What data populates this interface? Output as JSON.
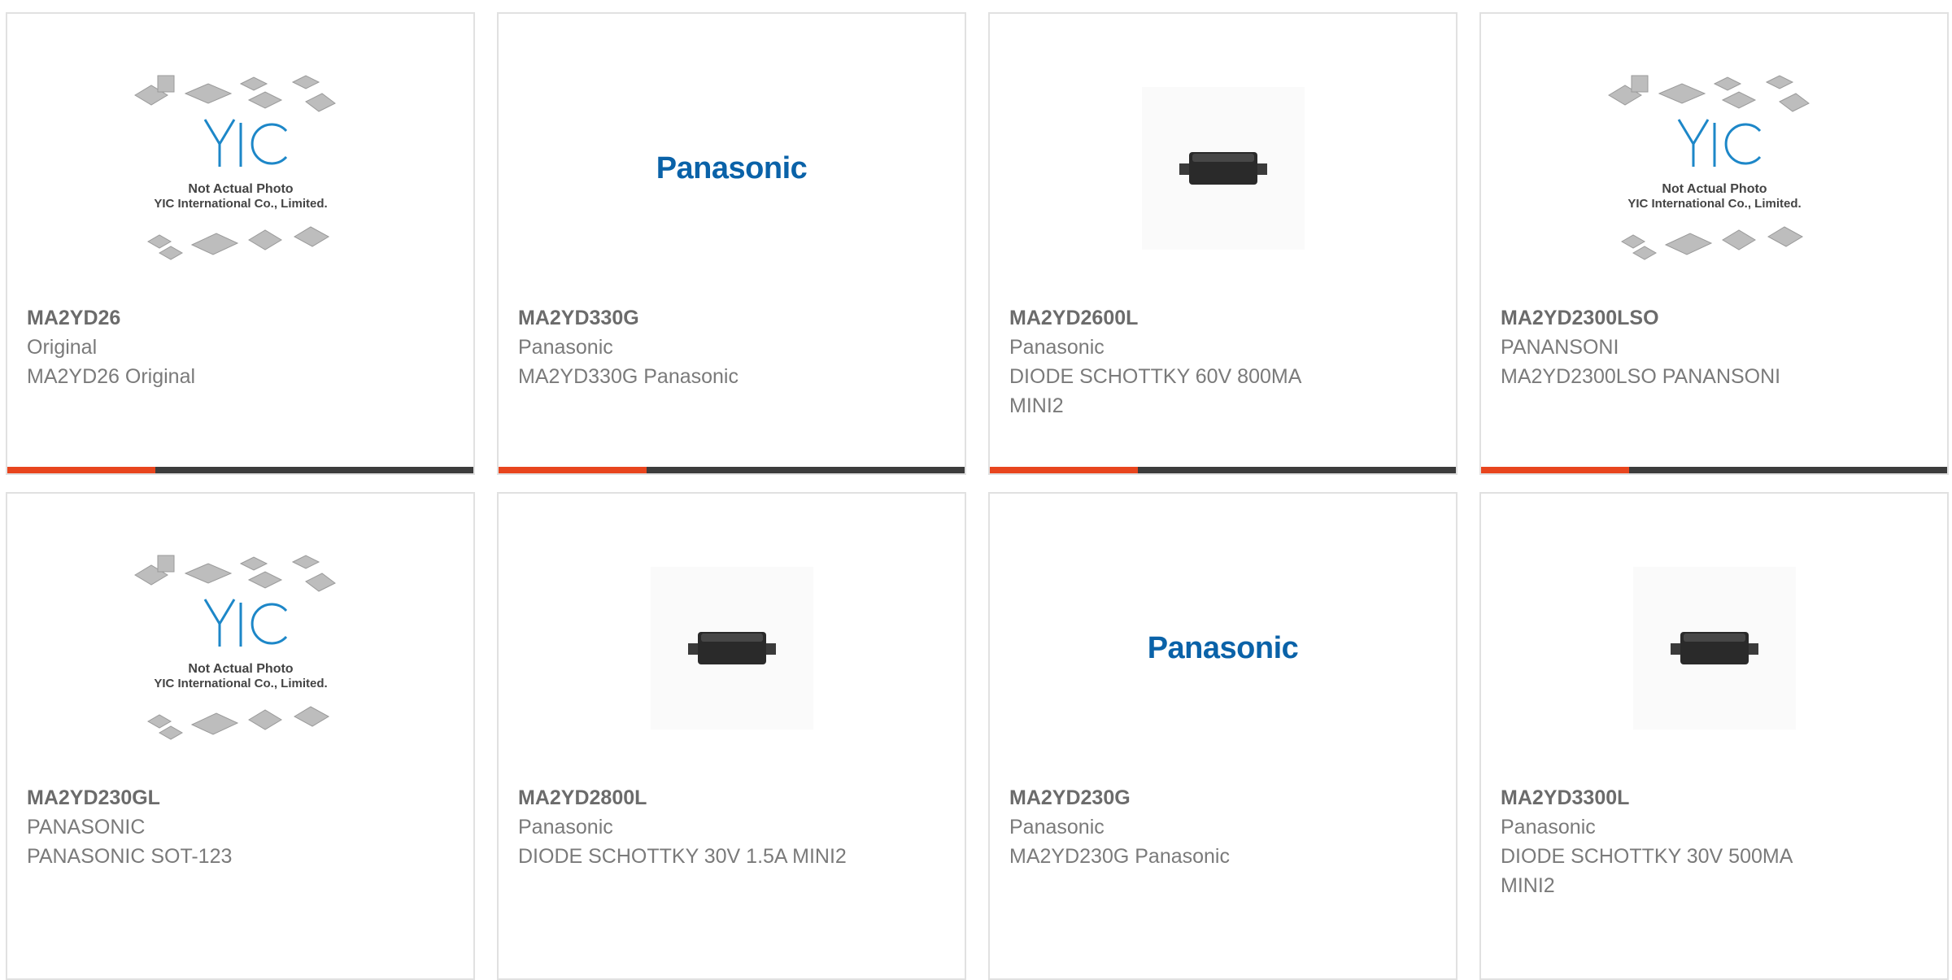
{
  "colors": {
    "accent": "#e8451e",
    "bar": "#3c3c3c",
    "panasonic_blue": "#0a62a8",
    "yic_blue": "#1d87c8"
  },
  "placeholder": {
    "line1": "Not Actual Photo",
    "line2": "YIC International Co., Limited.",
    "logo": "YIC"
  },
  "products": [
    {
      "part": "MA2YD26",
      "brand": "Original",
      "desc": "MA2YD26 Original",
      "image": "yic-placeholder"
    },
    {
      "part": "MA2YD330G",
      "brand": "Panasonic",
      "desc": "MA2YD330G Panasonic",
      "image": "panasonic-logo",
      "logo_text": "Panasonic"
    },
    {
      "part": "MA2YD2600L",
      "brand": "Panasonic",
      "desc": "DIODE SCHOTTKY 60V 800MA MINI2",
      "image": "diode-photo"
    },
    {
      "part": "MA2YD2300LSO",
      "brand": "PANANSONI",
      "desc": "MA2YD2300LSO PANANSONI",
      "image": "yic-placeholder"
    },
    {
      "part": "MA2YD230GL",
      "brand": "PANASONIC",
      "desc": "PANASONIC SOT-123",
      "image": "yic-placeholder"
    },
    {
      "part": "MA2YD2800L",
      "brand": "Panasonic",
      "desc": "DIODE SCHOTTKY 30V 1.5A MINI2",
      "image": "diode-photo"
    },
    {
      "part": "MA2YD230G",
      "brand": "Panasonic",
      "desc": "MA2YD230G Panasonic",
      "image": "panasonic-logo",
      "logo_text": "Panasonic"
    },
    {
      "part": "MA2YD3300L",
      "brand": "Panasonic",
      "desc": "DIODE SCHOTTKY 30V 500MA MINI2",
      "image": "diode-photo"
    }
  ]
}
